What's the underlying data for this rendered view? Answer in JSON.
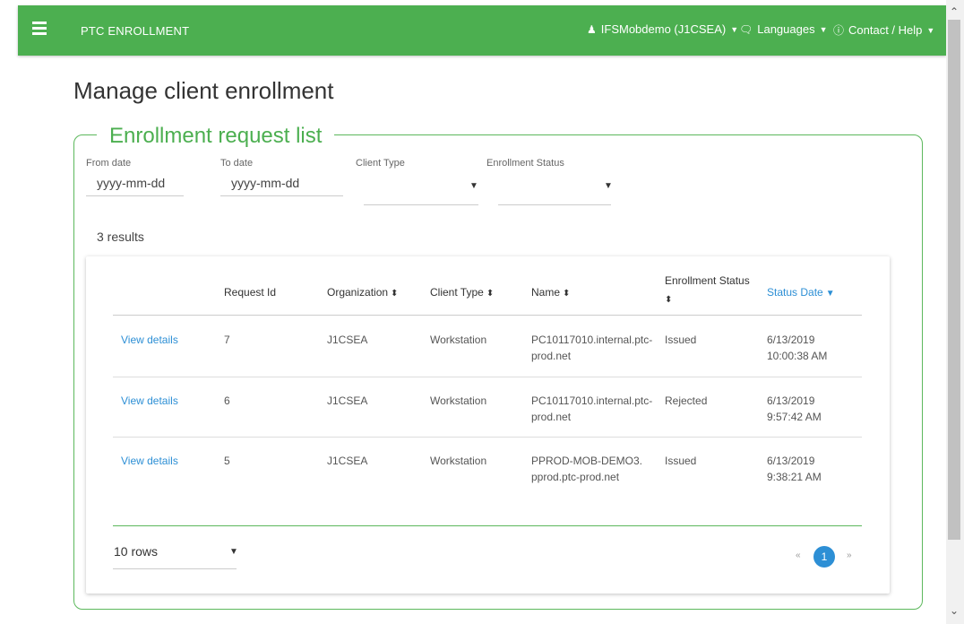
{
  "app": {
    "title": "PTC ENROLLMENT"
  },
  "nav": {
    "user_label": "IFSMobdemo (J1CSEA)",
    "languages_label": "Languages",
    "help_label": "Contact / Help"
  },
  "page": {
    "title": "Manage client enrollment"
  },
  "filters": {
    "legend": "Enrollment request list",
    "from_date": {
      "label": "From date",
      "value": "yyyy-mm-dd"
    },
    "to_date": {
      "label": "To date",
      "value": "yyyy-mm-dd"
    },
    "client_type": {
      "label": "Client Type",
      "value": ""
    },
    "enrollment_status": {
      "label": "Enrollment Status",
      "value": ""
    }
  },
  "results_text": "3 results",
  "table": {
    "columns": {
      "request_id": "Request Id",
      "organization": "Organization",
      "client_type": "Client Type",
      "name": "Name",
      "enrollment_status": "Enrollment Status",
      "status_date": "Status Date"
    },
    "rows": [
      {
        "action": "View details",
        "request_id": "7",
        "organization": "J1CSEA",
        "client_type": "Workstation",
        "name": "PC10117010.internal.ptc-prod.net",
        "status": "Issued",
        "date": "6/13/2019",
        "time": "10:00:38 AM"
      },
      {
        "action": "View details",
        "request_id": "6",
        "organization": "J1CSEA",
        "client_type": "Workstation",
        "name": "PC10117010.internal.ptc-prod.net",
        "status": "Rejected",
        "date": "6/13/2019",
        "time": "9:57:42 AM"
      },
      {
        "action": "View details",
        "request_id": "5",
        "organization": "J1CSEA",
        "client_type": "Workstation",
        "name": "PPROD-MOB-DEMO3.pprod.ptc-prod.net",
        "status": "Issued",
        "date": "6/13/2019",
        "time": "9:38:21 AM"
      }
    ]
  },
  "pagination": {
    "rows_per_page": "10 rows",
    "prev": "«",
    "current": "1",
    "next": "»"
  },
  "icons": {
    "menu": "hamburger-icon",
    "user": "user-icon",
    "languages": "chat-icon",
    "help": "help-circle-icon",
    "caret": "caret-down-icon",
    "sort": "sort-icon"
  },
  "colors": {
    "brand": "#4caf50",
    "link": "#2d8fd5",
    "fieldset_border": "#5cb85c"
  }
}
